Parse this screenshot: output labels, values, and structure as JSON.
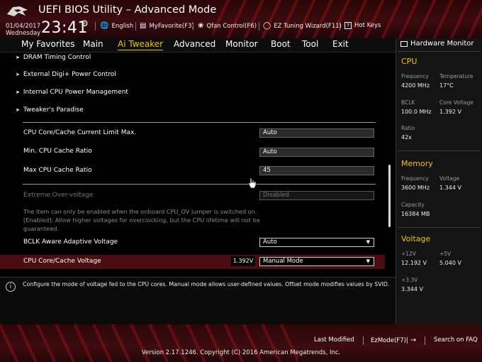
{
  "header": {
    "title": "UEFI BIOS Utility – Advanced Mode",
    "date": "01/04/2017",
    "weekday": "Wednesday",
    "time": "23:41",
    "buttons": [
      {
        "icon": "globe-icon",
        "label": "English"
      },
      {
        "icon": "star-list-icon",
        "label": "MyFavorite(F3)"
      },
      {
        "icon": "fan-icon",
        "label": "Qfan Control(F6)"
      },
      {
        "icon": "lightbulb-icon",
        "label": "EZ Tuning Wizard(F11)"
      },
      {
        "icon": "question-icon",
        "label": "Hot Keys"
      }
    ]
  },
  "nav": {
    "tabs": [
      "My Favorites",
      "Main",
      "Ai Tweaker",
      "Advanced",
      "Monitor",
      "Boot",
      "Tool",
      "Exit"
    ],
    "active": "Ai Tweaker"
  },
  "main": {
    "submenus": [
      "DRAM Timing Control",
      "External Digi+ Power Control",
      "Internal CPU Power Management",
      "Tweaker's Paradise"
    ],
    "settings": [
      {
        "label": "CPU Core/Cache Current Limit Max.",
        "value": "Auto"
      },
      {
        "label": "Min. CPU Cache Ratio",
        "value": "Auto"
      },
      {
        "label": "Max CPU Cache Ratio",
        "value": "45"
      },
      {
        "label": "Extreme Over-voltage",
        "value": "Disabled"
      },
      {
        "label": "BCLK Aware Adaptive Voltage",
        "value": "Auto"
      },
      {
        "label": "CPU Core/Cache Voltage",
        "value": "Manual Mode",
        "readout": "1.392V"
      }
    ],
    "help_note": [
      "The item can only be enabled when the onboard CPU_OV jumper is switched on.",
      "[Enabled]: Allow higher voltages for overclocking, but the CPU lifetime will not be",
      "guaranteed."
    ]
  },
  "info": {
    "text": "Configure the mode of voltage fed to the CPU cores. Manual mode allows user-defined values. Offset mode modifies values by SVID."
  },
  "hw_monitor": {
    "title": "Hardware Monitor",
    "cpu": {
      "heading": "CPU",
      "frequency_label": "Frequency",
      "frequency": "4200 MHz",
      "temperature_label": "Temperature",
      "temperature": "17°C",
      "bclk_label": "BCLK",
      "bclk": "100.0 MHz",
      "core_voltage_label": "Core Voltage",
      "core_voltage": "1.392 V",
      "ratio_label": "Ratio",
      "ratio": "42x"
    },
    "memory": {
      "heading": "Memory",
      "frequency_label": "Frequency",
      "frequency": "3600 MHz",
      "voltage_label": "Voltage",
      "voltage": "1.344 V",
      "capacity_label": "Capacity",
      "capacity": "16384 MB"
    },
    "voltage": {
      "heading": "Voltage",
      "v12_label": "+12V",
      "v12": "12.192 V",
      "v5_label": "+5V",
      "v5": "5.040 V",
      "v33_label": "+3.3V",
      "v33": "3.344 V"
    }
  },
  "footer": {
    "last_modified": "Last Modified",
    "ezmode": "EzMode(F7)|",
    "search_faq": "Search on FAQ",
    "version": "Version 2.17.1246. Copyright (C) 2016 American Megatrends, Inc."
  },
  "colors": {
    "accent": "#f2c400",
    "selected_row": "#4a0d11",
    "header_red": "#3a0b0e"
  }
}
